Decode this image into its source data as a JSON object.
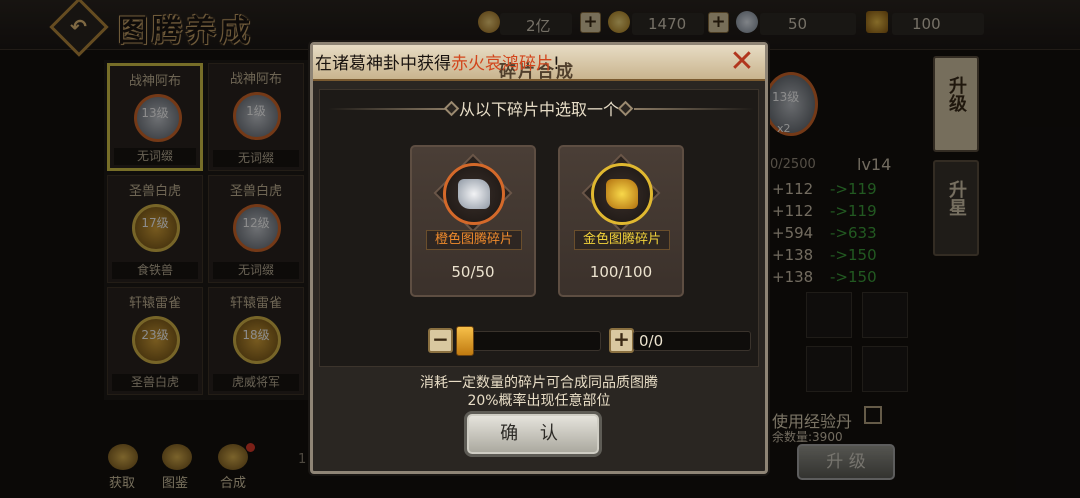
{
  "screen": {
    "title": "图腾养成"
  },
  "resources": [
    {
      "icon": "coin-icon",
      "value": "2亿"
    },
    {
      "icon": "gold-ingot-icon",
      "value": "1470"
    },
    {
      "icon": "feather-icon",
      "value": "50"
    },
    {
      "icon": "chest-icon",
      "value": "100"
    }
  ],
  "cards": [
    {
      "name": "战神阿布",
      "level": "13级",
      "foot": "无词缀",
      "emblem": "silver",
      "selected": true
    },
    {
      "name": "战神阿布",
      "level": "1级",
      "foot": "无词缀",
      "emblem": "silver",
      "selected": false
    },
    {
      "name": "圣兽白虎",
      "level": "17级",
      "foot": "食铁兽",
      "emblem": "gold",
      "selected": false
    },
    {
      "name": "圣兽白虎",
      "level": "12级",
      "foot": "无词缀",
      "emblem": "silver",
      "selected": false
    },
    {
      "name": "轩辕雷雀",
      "level": "23级",
      "foot": "圣兽白虎",
      "emblem": "gold",
      "selected": false
    },
    {
      "name": "轩辕雷雀",
      "level": "18级",
      "foot": "虎威将军",
      "emblem": "gold",
      "selected": false
    }
  ],
  "bottom_nav": [
    {
      "label": "获取",
      "icon": "obtain-icon"
    },
    {
      "label": "图鉴",
      "icon": "codex-icon"
    },
    {
      "label": "合成",
      "icon": "synthesize-icon"
    }
  ],
  "bg_partial_num": "1",
  "side_tabs": {
    "upgrade": "升级",
    "star_up": "升星"
  },
  "stats": [
    {
      "cur": "+112",
      "next": "->119"
    },
    {
      "cur": "+112",
      "next": "->119"
    },
    {
      "cur": "+594",
      "next": "->633"
    },
    {
      "cur": "+138",
      "next": "->150"
    },
    {
      "cur": "+138",
      "next": "->150"
    }
  ],
  "level_text": "lv14",
  "exp_text": "0/2500",
  "preview_level": "13级",
  "preview_count": "x2",
  "exp_item_label": "使用经验丹",
  "remaining_text": "余数量:3900",
  "bg_upgrade_button": "升 级",
  "modal": {
    "notice_prefix": "在诸葛神卦中获得",
    "notice_item": "赤火哀鸿碎片",
    "notice_suffix": "!",
    "header_ghost": "碎片合成",
    "subtitle": "从以下碎片中选取一个",
    "fragments": [
      {
        "label": "橙色图腾碎片",
        "count": "50/50",
        "color": "#f08b2c"
      },
      {
        "label": "金色图腾碎片",
        "count": "100/100",
        "color": "#f2d23a"
      }
    ],
    "slider": {
      "value": 0,
      "max": 0
    },
    "quantity_text": "0/0",
    "desc_line1": "消耗一定数量的碎片可合成同品质图腾",
    "desc_line2": "20%概率出现任意部位",
    "confirm_label": "确 认"
  },
  "colors": {
    "highlight": "#d2451c",
    "stat_green": "#3ea33c",
    "orange": "#f08b2c",
    "gold": "#f2d23a"
  }
}
